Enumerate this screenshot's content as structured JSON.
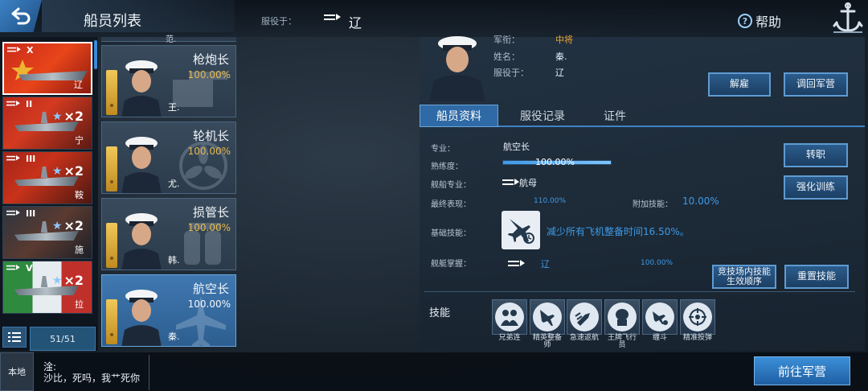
{
  "header": {
    "title": "船员列表",
    "served_label": "服役于：",
    "served_value": "辽",
    "help_label": "帮助"
  },
  "ships": [
    {
      "tier": "X",
      "count": "",
      "name": "辽",
      "selected": true
    },
    {
      "tier": "II",
      "count": "×2",
      "name": "宁"
    },
    {
      "tier": "III",
      "count": "×2",
      "name": "鞍"
    },
    {
      "tier": "III",
      "count": "×2",
      "name": "施"
    },
    {
      "tier": "V",
      "count": "×2",
      "name": "拉"
    }
  ],
  "list_count": "51/51",
  "roles": [
    {
      "title": "枪炮长",
      "pct": "100.00%",
      "person": "王."
    },
    {
      "title": "轮机长",
      "pct": "100.00%",
      "person": "尤."
    },
    {
      "title": "损管长",
      "pct": "100.00%",
      "person": "韩."
    },
    {
      "title": "航空长",
      "pct": "100.00%",
      "person": "秦.",
      "selected": true
    }
  ],
  "partial_role_person": "范.",
  "officer": {
    "rank_label": "军衔：",
    "rank_value": "中将",
    "name_label": "姓名：",
    "name_value": "秦.",
    "served_label": "服役于：",
    "served_value": "辽"
  },
  "buttons": {
    "dismiss": "解雇",
    "recall": "调回军营",
    "transfer": "转职",
    "train": "强化训练",
    "arena_order": "竞技场内技能生效顺序",
    "reset": "重置技能",
    "goto_camp": "前往军营"
  },
  "tabs": [
    "船员资料",
    "服役记录",
    "证件"
  ],
  "profile": {
    "specialty_label": "专业：",
    "specialty_value": "航空长",
    "proficiency_label": "熟练度：",
    "proficiency_value": "100.00%",
    "proficiency_fraction": 1.0,
    "ship_specialty_label": "舰船专业：",
    "ship_specialty_value": "航母",
    "final_label": "最终表现：",
    "final_value": "110.00%",
    "bonus_label": "附加技能：",
    "bonus_value": "10.00%",
    "base_skill_label": "基础技能：",
    "base_skill_desc": "减少所有飞机整备时间16.50%。",
    "mastery_label": "舰艇掌握：",
    "mastery_ship": "辽",
    "mastery_value": "100.00%"
  },
  "skills_label": "技能",
  "skills": [
    {
      "name": "兄弟连",
      "icon": "brotherhood-icon"
    },
    {
      "name": "精英整备师",
      "icon": "elite-mechanic-icon"
    },
    {
      "name": "急速返航",
      "icon": "rapid-return-icon"
    },
    {
      "name": "王牌飞行员",
      "icon": "ace-pilot-icon"
    },
    {
      "name": "缠斗",
      "icon": "dogfight-icon"
    },
    {
      "name": "精准投弹",
      "icon": "precision-bombing-icon"
    }
  ],
  "chat": {
    "channel": "本地",
    "user": "淦:",
    "message": "沙比，死吗，我艹死你"
  },
  "colors": {
    "accent": "#3d84c6",
    "rank": "#e8a534",
    "highlight_text": "#3d9be8",
    "percent": "#e8b84a"
  }
}
